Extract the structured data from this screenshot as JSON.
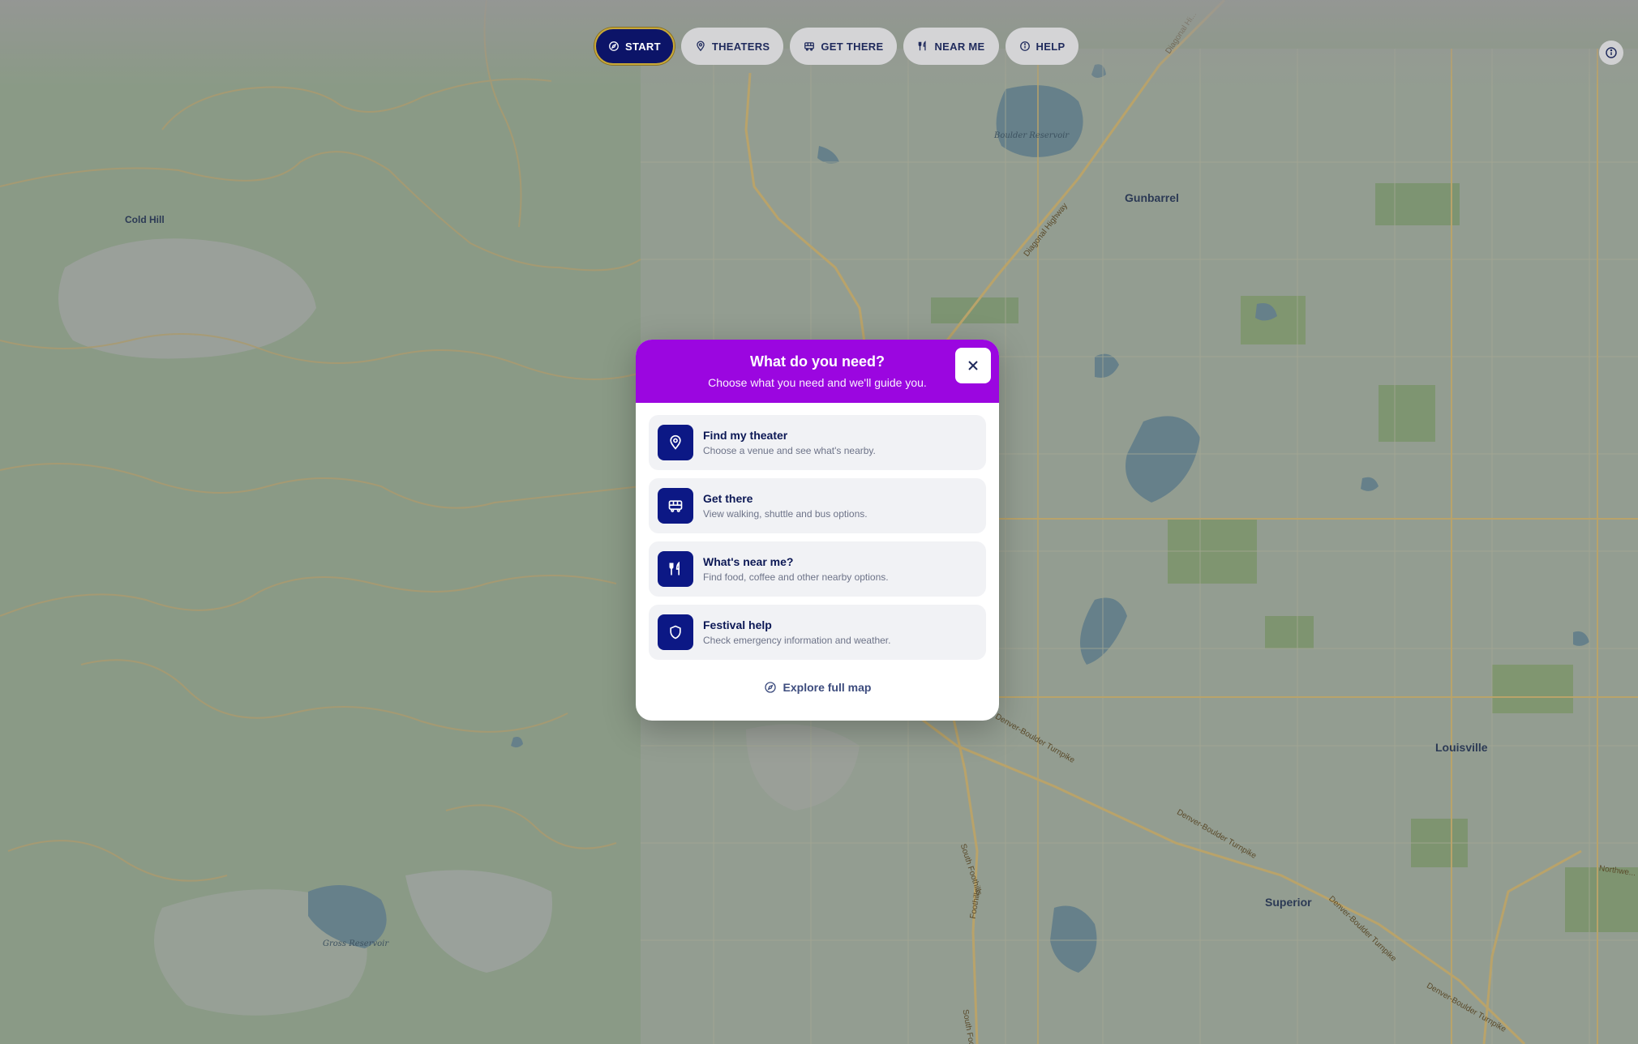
{
  "colors": {
    "map_base": "#8a9a86",
    "nav_active_bg": "#0c1468",
    "nav_active_border": "#c8a93a",
    "nav_bg": "#d4d4d6",
    "nav_text": "#1f2a5c",
    "modal_header": "#9b06e0",
    "option_icon_bg": "#0c1885",
    "option_title": "#0c1855"
  },
  "nav": {
    "items": [
      {
        "label": "START",
        "icon": "compass-icon",
        "active": true
      },
      {
        "label": "THEATERS",
        "icon": "map-pin-icon",
        "active": false
      },
      {
        "label": "GET THERE",
        "icon": "bus-icon",
        "active": false
      },
      {
        "label": "NEAR ME",
        "icon": "utensils-icon",
        "active": false
      },
      {
        "label": "HELP",
        "icon": "info-icon",
        "active": false
      }
    ],
    "info_icon": "info-icon"
  },
  "modal": {
    "title": "What do you need?",
    "subtitle": "Choose what you need and we'll guide you.",
    "close_icon": "close-icon",
    "options": [
      {
        "title": "Find my theater",
        "description": "Choose a venue and see what's nearby.",
        "icon": "map-pin-icon"
      },
      {
        "title": "Get there",
        "description": "View walking, shuttle and bus options.",
        "icon": "bus-icon"
      },
      {
        "title": "What's near me?",
        "description": "Find food, coffee and other nearby options.",
        "icon": "utensils-icon"
      },
      {
        "title": "Festival help",
        "description": "Check emergency information and weather.",
        "icon": "shield-icon"
      }
    ],
    "explore_label": "Explore full map",
    "explore_icon": "compass-icon"
  },
  "map": {
    "places": {
      "cold_hill": "Cold Hill",
      "gunbarrel": "Gunbarrel",
      "louisville": "Louisville",
      "superior": "Superior"
    },
    "water": {
      "boulder_reservoir": "Boulder Reservoir",
      "gross_reservoir": "Gross Reservoir"
    },
    "roads": {
      "diagonal_top": "Diagonal Hi...",
      "diagonal_highway": "Diagonal Highway",
      "denver_boulder_1": "Denver-Boulder Turnpike",
      "denver_boulder_2": "Denver-Boulder Turnpike",
      "denver_boulder_3": "Denver-Boulder Turnpike",
      "denver_boulder_4": "Denver-Boulder Turnpike",
      "south_foothills": "South Foothills",
      "foothills_2": "Foothills",
      "south_foot": "South Foot...",
      "northwest": "Northwe..."
    }
  }
}
